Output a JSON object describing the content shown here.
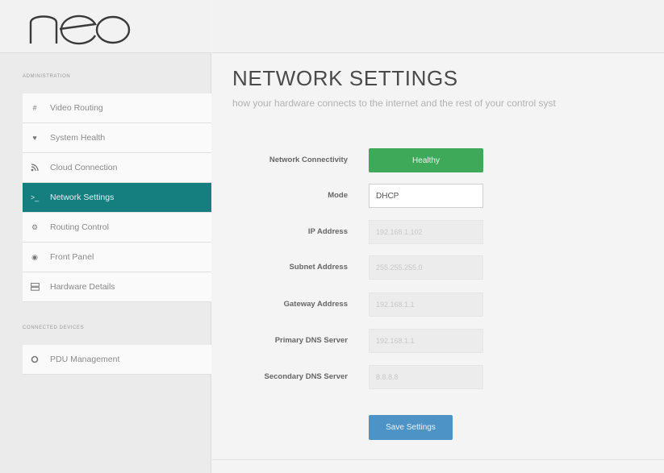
{
  "brand": {
    "logo_text": "neo"
  },
  "sidebar": {
    "sections": [
      {
        "header": "ADMINISTRATION",
        "items": [
          {
            "label": "Video Routing",
            "icon": "hash-icon"
          },
          {
            "label": "System Health",
            "icon": "heart-icon"
          },
          {
            "label": "Cloud Connection",
            "icon": "rss-icon"
          },
          {
            "label": "Network Settings",
            "icon": "terminal-icon",
            "active": true
          },
          {
            "label": "Routing Control",
            "icon": "gears-icon"
          },
          {
            "label": "Front Panel",
            "icon": "circle-dot-icon"
          },
          {
            "label": "Hardware Details",
            "icon": "server-icon"
          }
        ]
      },
      {
        "header": "CONNECTED DEVICES",
        "items": [
          {
            "label": "PDU Management",
            "icon": "power-ring-icon"
          }
        ]
      }
    ]
  },
  "main": {
    "title": "NETWORK SETTINGS",
    "subtitle": "how your hardware connects to the internet and the rest of your control syst",
    "form": {
      "network_connectivity": {
        "label": "Network Connectivity",
        "value": "Healthy"
      },
      "mode": {
        "label": "Mode",
        "value": "DHCP"
      },
      "ip_address": {
        "label": "IP Address",
        "value": "192.168.1.102"
      },
      "subnet_address": {
        "label": "Subnet Address",
        "value": "255.255.255.0"
      },
      "gateway_address": {
        "label": "Gateway Address",
        "value": "192.168.1.1"
      },
      "primary_dns": {
        "label": "Primary DNS Server",
        "value": "192.168.1.1"
      },
      "secondary_dns": {
        "label": "Secondary DNS Server",
        "value": "8.8.8.8"
      }
    },
    "save_label": "Save Settings"
  },
  "colors": {
    "accent": "#157e7f",
    "healthy": "#3fa95a",
    "button": "#4e93c6"
  }
}
